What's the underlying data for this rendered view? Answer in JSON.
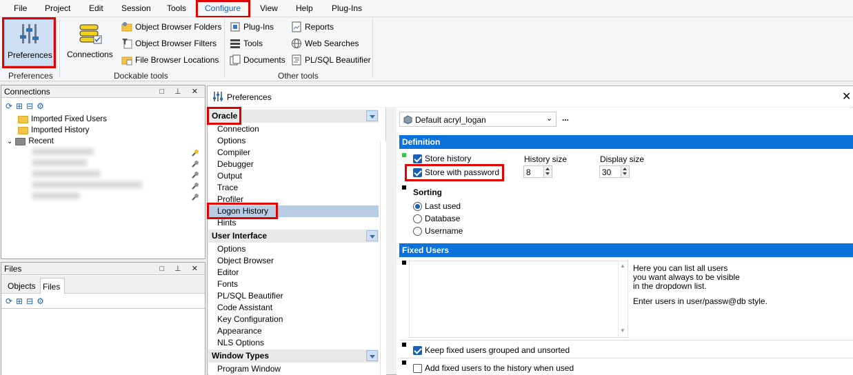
{
  "menu": [
    "File",
    "Project",
    "Edit",
    "Session",
    "Tools",
    "Configure",
    "View",
    "Help",
    "Plug-Ins"
  ],
  "ribbon": {
    "preferences_label": "Preferences",
    "preferences_group": "Preferences",
    "connections_label": "Connections",
    "dockable": [
      "Object Browser Folders",
      "Object Browser Filters",
      "File Browser Locations"
    ],
    "dockable_group": "Dockable tools",
    "other_col1": [
      "Plug-Ins",
      "Tools",
      "Documents"
    ],
    "other_col2": [
      "Reports",
      "Web Searches",
      "PL/SQL Beautifier"
    ],
    "other_group": "Other tools"
  },
  "connections_panel": {
    "title": "Connections",
    "items": [
      "Imported Fixed Users",
      "Imported History",
      "Recent"
    ]
  },
  "files_panel": {
    "title": "Files",
    "tabs": [
      "Objects",
      "Files"
    ]
  },
  "prefs": {
    "title": "Preferences",
    "categories": [
      {
        "name": "Oracle",
        "items": [
          "Connection",
          "Options",
          "Compiler",
          "Debugger",
          "Output",
          "Trace",
          "Profiler",
          "Logon History",
          "Hints"
        ]
      },
      {
        "name": "User Interface",
        "items": [
          "Options",
          "Object Browser",
          "Editor",
          "Fonts",
          "PL/SQL Beautifier",
          "Code Assistant",
          "Key Configuration",
          "Appearance",
          "NLS Options"
        ]
      },
      {
        "name": "Window Types",
        "items": [
          "Program Window"
        ]
      }
    ],
    "profile": "Default acryl_logan",
    "more": "...",
    "definition": {
      "header": "Definition",
      "store_history": "Store history",
      "store_with_password": "Store with password",
      "history_size_label": "History size",
      "history_size": "8",
      "display_size_label": "Display size",
      "display_size": "30"
    },
    "sorting": {
      "header": "Sorting",
      "options": [
        "Last used",
        "Database",
        "Username"
      ],
      "selected": "Last used"
    },
    "fixed_users": {
      "header": "Fixed Users",
      "help1": "Here you can list all users",
      "help2": "you want always to be visible",
      "help3": "in the dropdown list.",
      "help4": "Enter users in user/passw@db style.",
      "keep_grouped": "Keep fixed users grouped and unsorted",
      "add_to_history": "Add fixed users to the history when used"
    }
  },
  "colors": {
    "accent": "#0a72d8",
    "highlight": "#e00000",
    "selection": "#b8cce4"
  }
}
